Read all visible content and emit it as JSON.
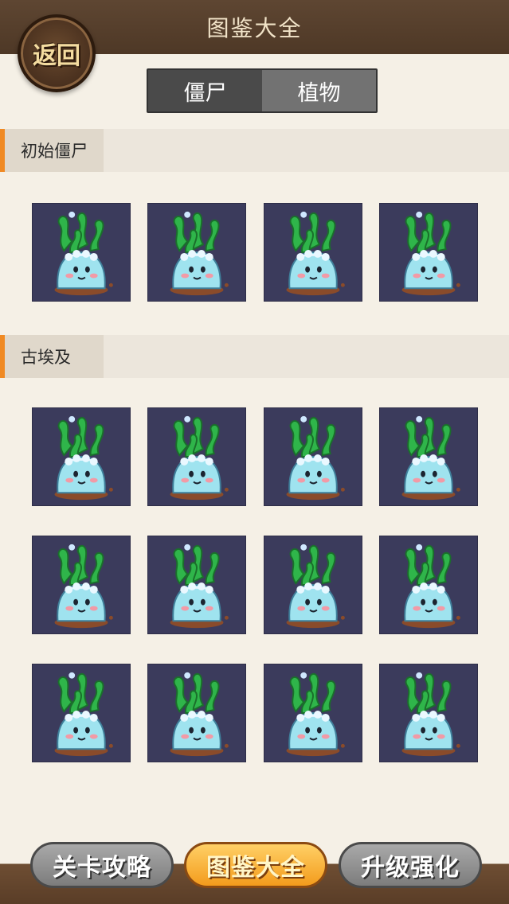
{
  "header": {
    "title": "图鉴大全",
    "back_label": "返回"
  },
  "tabs": [
    {
      "label": "僵尸",
      "active": true
    },
    {
      "label": "植物",
      "active": false
    }
  ],
  "sections": [
    {
      "label": "初始僵尸",
      "item_count": 4,
      "item_icon": "seaweed-slime-zombie"
    },
    {
      "label": "古埃及",
      "item_count": 12,
      "item_icon": "seaweed-slime-zombie"
    }
  ],
  "bottom_nav": [
    {
      "label": "关卡攻略",
      "active": false
    },
    {
      "label": "图鉴大全",
      "active": true
    },
    {
      "label": "升级强化",
      "active": false
    }
  ],
  "colors": {
    "header_bg": "#4e3826",
    "accent": "#f08a24",
    "card_bg": "#3b3b5c",
    "active_tab": "#4a4a4a",
    "gold_button": "#f39b1c"
  }
}
